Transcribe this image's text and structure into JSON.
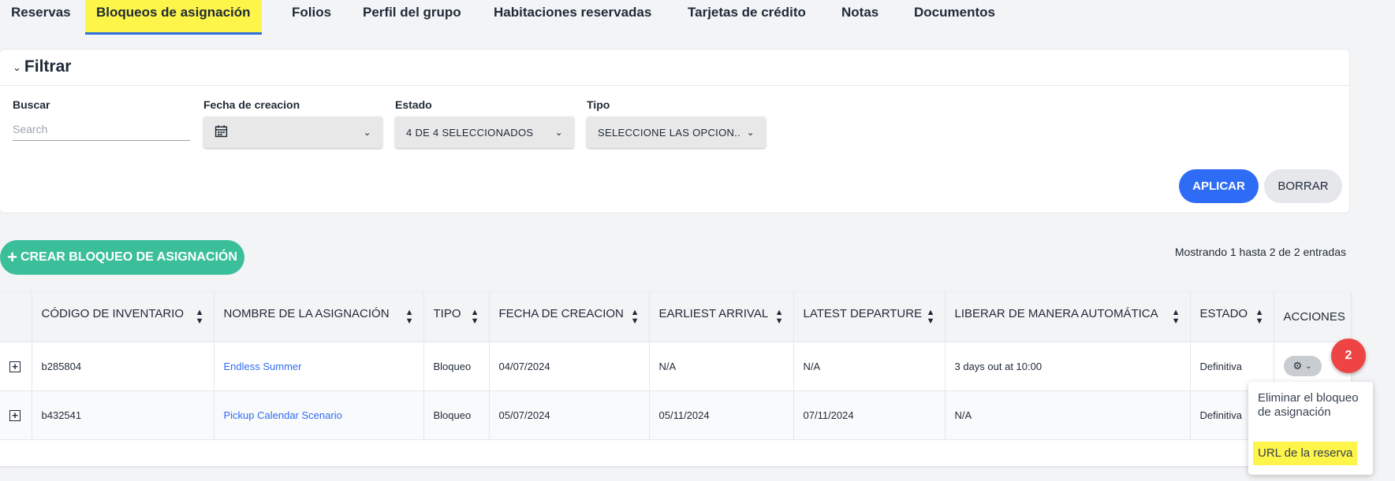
{
  "tabs": [
    {
      "label": "Reservas"
    },
    {
      "label": "Bloqueos de asignación",
      "active": true
    },
    {
      "label": "Folios"
    },
    {
      "label": "Perfil del grupo"
    },
    {
      "label": "Habitaciones reservadas"
    },
    {
      "label": "Tarjetas de crédito"
    },
    {
      "label": "Notas"
    },
    {
      "label": "Documentos"
    }
  ],
  "filter": {
    "title": "Filtrar",
    "search": {
      "label": "Buscar",
      "placeholder": "Search"
    },
    "creation_date": {
      "label": "Fecha de creacion",
      "value": ""
    },
    "status": {
      "label": "Estado",
      "value": "4 DE 4 SELECCIONADOS"
    },
    "type": {
      "label": "Tipo",
      "value": "SELECCIONE LAS OPCION..."
    },
    "apply_label": "APLICAR",
    "clear_label": "BORRAR"
  },
  "create_button_label": "CREAR BLOQUEO DE ASIGNACIÓN",
  "showing_text": "Mostrando 1 hasta 2 de 2 entradas",
  "table": {
    "columns": [
      "CÓDIGO DE INVENTARIO",
      "NOMBRE DE LA ASIGNACIÓN",
      "TIPO",
      "FECHA DE CREACION",
      "EARLIEST ARRIVAL",
      "LATEST DEPARTURE",
      "LIBERAR DE MANERA AUTOMÁTICA",
      "ESTADO",
      "ACCIONES"
    ],
    "rows": [
      {
        "code": "b285804",
        "name": "Endless Summer",
        "type": "Bloqueo",
        "created": "04/07/2024",
        "arrival": "N/A",
        "departure": "N/A",
        "auto_release": "3 days out at 10:00",
        "status": "Definitiva"
      },
      {
        "code": "b432541",
        "name": "Pickup Calendar Scenario",
        "type": "Bloqueo",
        "created": "05/07/2024",
        "arrival": "05/11/2024",
        "departure": "07/11/2024",
        "auto_release": "N/A",
        "status": "Definitiva"
      }
    ]
  },
  "step_badge": "2",
  "actions_menu": {
    "delete_label": "Eliminar el bloqueo de asignación",
    "url_label": "URL de la reserva"
  },
  "colors": {
    "accent": "#2f6cf6",
    "create": "#3bbf9b",
    "highlight": "#fdf54a",
    "badge": "#ef4444"
  }
}
